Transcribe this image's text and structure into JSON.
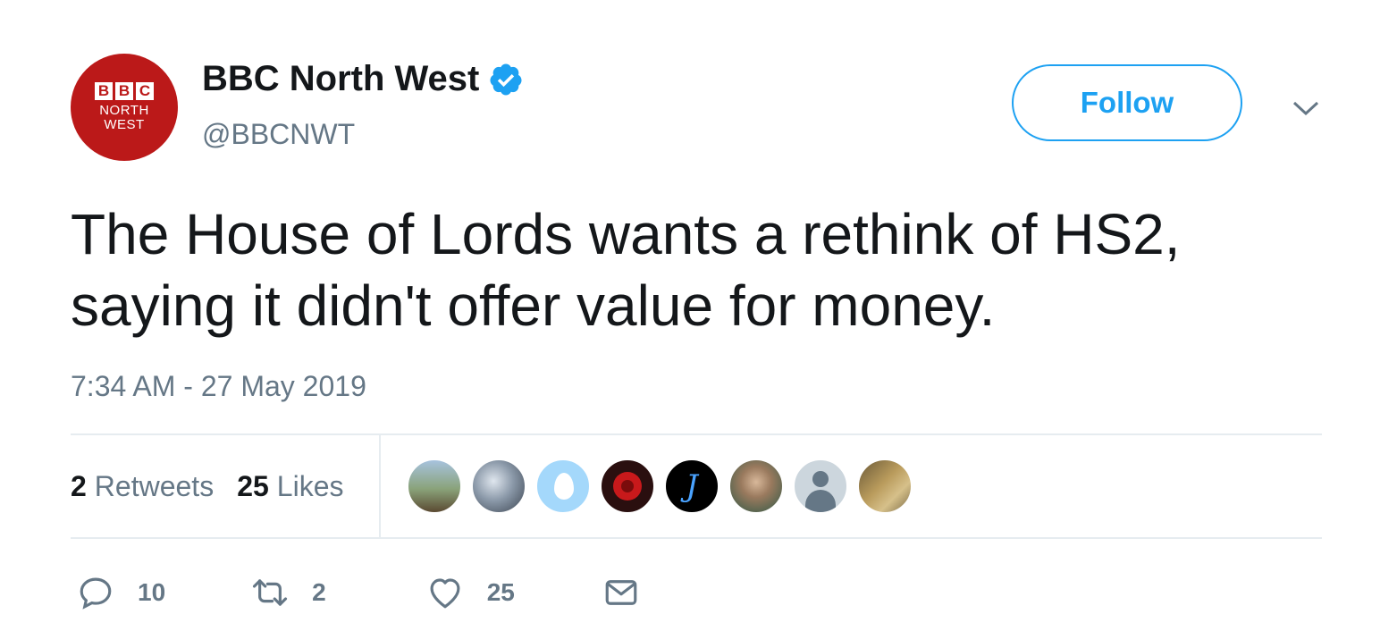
{
  "account": {
    "name": "BBC North West",
    "handle": "@BBCNWT",
    "avatar_text": {
      "blocks": [
        "B",
        "B",
        "C"
      ],
      "line1": "NORTH",
      "line2": "WEST"
    },
    "avatar_color": "#bb1919",
    "verified": true
  },
  "follow_label": "Follow",
  "tweet": {
    "line1": "The House of Lords wants a rethink of HS2,",
    "line2": "saying it didn't offer value for money.",
    "timestamp": "7:34 AM - 27 May 2019"
  },
  "stats": {
    "retweets_count": "2",
    "retweets_label": "Retweets",
    "likes_count": "25",
    "likes_label": "Likes"
  },
  "actions": {
    "reply_count": "10",
    "retweet_count": "2",
    "like_count": "25"
  },
  "icons": {
    "verified": "verified-badge-icon",
    "caret": "chevron-down-icon",
    "reply": "reply-icon",
    "retweet": "retweet-icon",
    "like": "heart-icon",
    "dm": "envelope-icon"
  },
  "colors": {
    "accent": "#1da1f2",
    "text": "#14171a",
    "muted": "#657786",
    "divider": "#e6ecf0"
  }
}
